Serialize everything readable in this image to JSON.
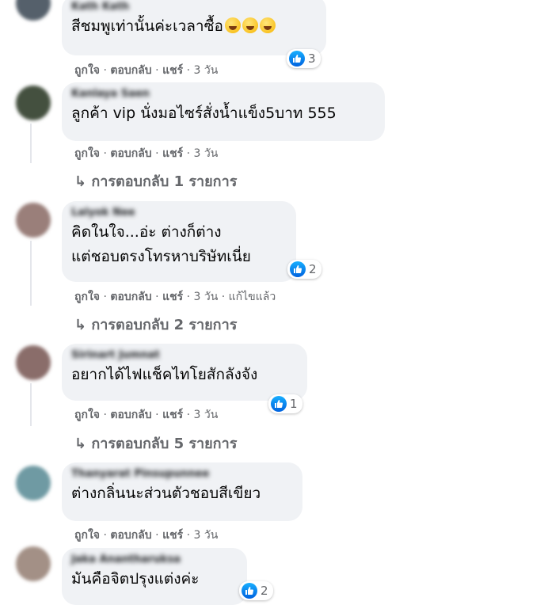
{
  "actions": {
    "like": "ถูกใจ",
    "reply": "ตอบกลับ",
    "share": "แชร์",
    "sep": "·"
  },
  "comments": [
    {
      "author": "Kath Kath",
      "text": "สีชมพูเท่านั้นค่ะเวลาซื้อ",
      "emoji": [
        "grinning-squint-face",
        "grinning-squint-face",
        "grinning-squint-face"
      ],
      "react_count": "3",
      "time": "3 วัน"
    },
    {
      "author": "Kanlaya Saen",
      "text": "ลูกค้า vip นั่งมอไซร์สั่งน้ำแข็ง5บาท 555",
      "time": "3 วัน",
      "replies": "↳ การตอบกลับ 1 รายการ"
    },
    {
      "author": "Lalyok Nee",
      "text": "คิดในใจ...อ่ะ ต่างก็ต่าง\nแต่ชอบตรงโทรหาบริษัทเนี่ย",
      "react_count": "2",
      "time": "3 วัน",
      "edited": "แก้ไขแล้ว",
      "replies": "↳ การตอบกลับ 2 รายการ"
    },
    {
      "author": "Sirinart Jumnat",
      "text": "อยากได้ไฟแช็คไทโยสักลังจัง",
      "react_count": "1",
      "time": "3 วัน",
      "replies": "↳ การตอบกลับ 5 รายการ"
    },
    {
      "author": "Thanyarat Pinsupunnee",
      "text": "ต่างกลิ่นนะส่วนตัวชอบสีเขียว",
      "time": "3 วัน"
    },
    {
      "author": "Jaka Anantharuksa",
      "text": "มันคือจิตปรุงแต่งค่ะ",
      "react_count": "2"
    }
  ],
  "colors": {
    "bubble": "#f0f2f5",
    "meta": "#65676b",
    "like": "#1877f2"
  }
}
